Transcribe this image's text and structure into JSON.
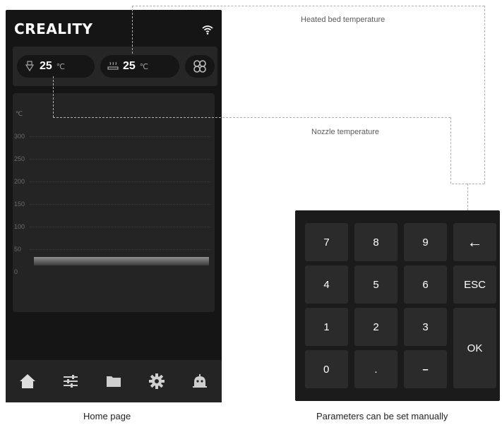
{
  "home_screen": {
    "brand": "CREALITY",
    "status": {
      "nozzle_temp": "25",
      "nozzle_unit": "℃",
      "bed_temp": "25",
      "bed_unit": "℃"
    },
    "graph": {
      "unit": "℃",
      "y_labels": [
        "300",
        "250",
        "200",
        "150",
        "100",
        "50",
        "0"
      ]
    },
    "nav": [
      "home-icon",
      "settings-sliders-icon",
      "folder-icon",
      "gear-icon",
      "robot-icon"
    ]
  },
  "keypad": {
    "keys": [
      "7",
      "8",
      "9",
      "←",
      "4",
      "5",
      "6",
      "ESC",
      "1",
      "2",
      "3",
      "OK",
      "0",
      ".",
      "–"
    ]
  },
  "annotations": {
    "heated_bed": "Heated bed temperature",
    "nozzle": "Nozzle temperature"
  },
  "captions": {
    "home": "Home page",
    "keypad": "Parameters can be set manually"
  }
}
